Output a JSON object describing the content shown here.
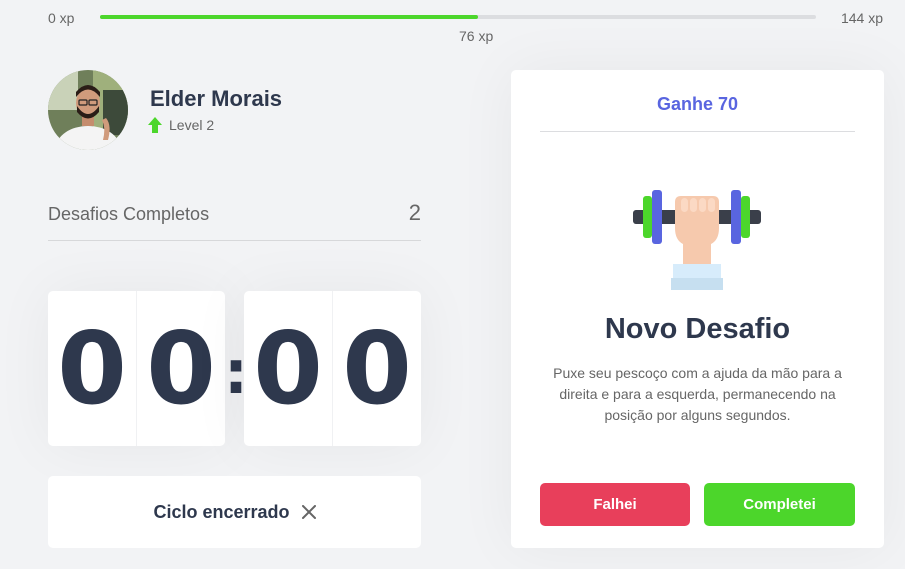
{
  "xp": {
    "min_label": "0 xp",
    "max_label": "144 xp",
    "current_label": "76 xp",
    "progress_fraction": 0.528,
    "fill_color": "#4cd62b"
  },
  "profile": {
    "name": "Elder Morais",
    "level_label": "Level 2",
    "level_icon": "level-up-arrow-icon"
  },
  "completed": {
    "label": "Desafios Completos",
    "value": "2"
  },
  "countdown": {
    "minute_left": "0",
    "minute_right": "0",
    "separator": ":",
    "second_left": "0",
    "second_right": "0"
  },
  "cycle_button": {
    "label": "Ciclo encerrado",
    "icon": "close-icon"
  },
  "challenge": {
    "header": "Ganhe 70",
    "icon": "dumbbell-body-icon",
    "title": "Novo Desafio",
    "description": "Puxe seu pescoço com a ajuda da mão para a direita e para a esquerda, permanecendo na posição por alguns segundos.",
    "fail_label": "Falhei",
    "success_label": "Completei",
    "fail_color": "#e83f5b",
    "success_color": "#4cd62b",
    "accent_color": "#5965e0"
  }
}
